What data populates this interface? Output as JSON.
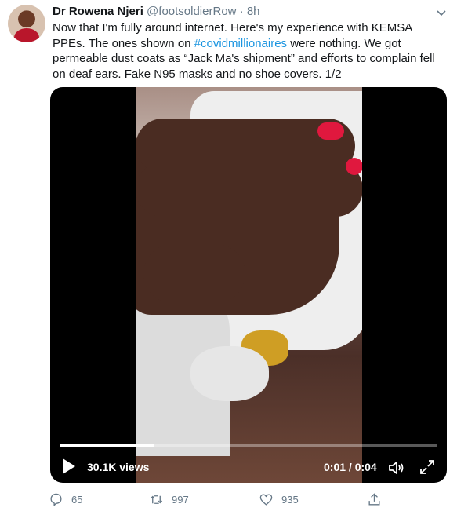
{
  "tweet": {
    "author_name": "Dr Rowena Njeri",
    "handle_time": "@footsoldierRow · 8h",
    "text_before": "Now that I'm fully around internet. Here's my experience with KEMSA PPEs. The ones shown on ",
    "hashtag": "#covidmillionaires",
    "text_after": " were nothing. We got permeable dust coats as “Jack Ma's shipment” and efforts to complain fell on deaf ears. Fake N95 masks and no shoe covers. 1/2"
  },
  "video": {
    "views": "30.1K views",
    "time": "0:01 / 0:04",
    "progress_fraction": 0.25
  },
  "actions": {
    "replies": "65",
    "retweets": "997",
    "likes": "935"
  },
  "colors": {
    "accent": "#1b95e0",
    "muted": "#657786",
    "nail": "#e0183e"
  }
}
